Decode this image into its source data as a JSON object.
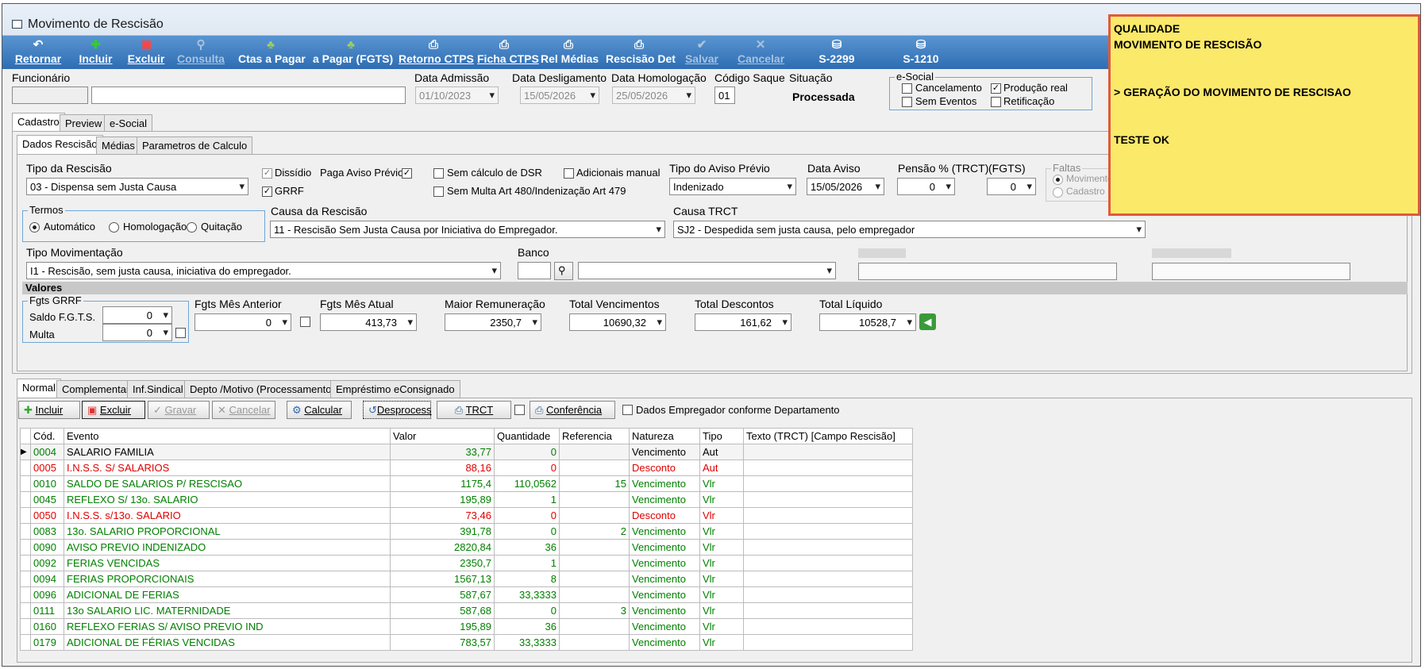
{
  "window": {
    "title": "Movimento de Rescisão"
  },
  "toolbar": [
    "Retornar",
    "Incluir",
    "Excluir",
    "Consulta",
    "Ctas a Pagar",
    "a Pagar (FGTS)",
    "Retorno CTPS",
    "Ficha CTPS",
    "Rel Médias",
    "Rescisão Det",
    "Salvar",
    "Cancelar",
    "S-2299",
    "S-1210"
  ],
  "header": {
    "funcionario_label": "Funcionário",
    "data_admissao_label": "Data Admissão",
    "data_admissao": "01/10/2023",
    "data_desligamento_label": "Data Desligamento",
    "data_desligamento": "15/05/2026",
    "data_homologacao_label": "Data Homologação",
    "data_homologacao": "25/05/2026",
    "codigo_saque_label": "Código Saque",
    "codigo_saque": "01",
    "situacao_label": "Situação",
    "situacao": "Processada",
    "esocial_label": "e-Social",
    "cancelamento": "Cancelamento",
    "producao_real": "Produção real",
    "sem_eventos": "Sem Eventos",
    "retificacao": "Retificação"
  },
  "note": {
    "l1": "QUALIDADE",
    "l2": "MOVIMENTO DE RESCISÃO",
    "l3": "> GERAÇÃO DO MOVIMENTO DE RESCISAO",
    "l4": "TESTE OK"
  },
  "tabs_top": [
    "Cadastro",
    "Preview",
    "e-Social"
  ],
  "tabs_sub": [
    "Dados Rescisão",
    "Médias",
    "Parametros de Calculo"
  ],
  "form": {
    "tipo_rescisao_label": "Tipo da Rescisão",
    "tipo_rescisao": "03 - Dispensa sem Justa Causa",
    "dissidio": "Dissídio",
    "grrf": "GRRF",
    "paga_aviso": "Paga Aviso Prévio",
    "sem_dsr": "Sem cálculo de DSR",
    "sem_multa": "Sem Multa Art 480/Indenização Art 479",
    "adicionais": "Adicionais manual",
    "tipo_aviso_label": "Tipo do Aviso Prévio",
    "tipo_aviso": "Indenizado",
    "data_aviso_label": "Data Aviso",
    "data_aviso": "15/05/2026",
    "pensao_label": "Pensão % (TRCT)",
    "pensao": "0",
    "fgts_label": "(FGTS)",
    "fgts": "0",
    "faltas_label": "Faltas",
    "movimento": "Movimento",
    "cadastro": "Cadastro",
    "termos_label": "Termos",
    "automatico": "Automático",
    "homologacao": "Homologação",
    "quitacao": "Quitação",
    "causa_label": "Causa da Rescisão",
    "causa": "11 - Rescisão Sem Justa Causa por Iniciativa do Empregador.",
    "causa_trct_label": "Causa TRCT",
    "causa_trct": "SJ2 - Despedida sem justa causa, pelo empregador",
    "tipo_mov_label": "Tipo Movimentação",
    "tipo_mov": "I1 - Rescisão, sem justa causa, iniciativa do empregador.",
    "banco_label": "Banco"
  },
  "valores": {
    "title": "Valores",
    "fgts_grrf": "Fgts GRRF",
    "saldo_label": "Saldo F.G.T.S.",
    "saldo": "0",
    "multa_label": "Multa",
    "multa": "0",
    "mes_ant_label": "Fgts Mês Anterior",
    "mes_ant": "0",
    "mes_atual_label": "Fgts Mês Atual",
    "mes_atual": "413,73",
    "maior_label": "Maior Remuneração",
    "maior": "2350,7",
    "venc_label": "Total Vencimentos",
    "venc": "10690,32",
    "desc_label": "Total Descontos",
    "desc": "161,62",
    "liq_label": "Total Líquido",
    "liq": "10528,7"
  },
  "tabs_bottom": [
    "Normal",
    "Complementar",
    "Inf.Sindical",
    "Depto /Motivo (Processamento)",
    "Empréstimo eConsignado"
  ],
  "actions": {
    "incluir": "Incluir",
    "excluir": "Excluir",
    "gravar": "Gravar",
    "cancelar": "Cancelar",
    "calcular": "Calcular",
    "desprocess": "Desprocess",
    "trct": "TRCT",
    "conferencia": "Conferência",
    "dados_emp": "Dados Empregador conforme Departamento"
  },
  "grid": {
    "columns": [
      "Cód.",
      "Evento",
      "Valor",
      "Quantidade",
      "Referencia",
      "Natureza",
      "Tipo",
      "Texto (TRCT) [Campo Rescisão]"
    ],
    "rows": [
      [
        "0004",
        "SALARIO FAMILIA",
        "33,77",
        "0",
        "",
        "Vencimento",
        "Aut"
      ],
      [
        "0005",
        "I.N.S.S. S/ SALARIOS",
        "88,16",
        "0",
        "",
        "Desconto",
        "Aut"
      ],
      [
        "0010",
        "SALDO DE SALARIOS P/ RESCISAO",
        "1175,4",
        "110,0562",
        "15",
        "Vencimento",
        "Vlr"
      ],
      [
        "0045",
        "REFLEXO S/ 13o. SALARIO",
        "195,89",
        "1",
        "",
        "Vencimento",
        "Vlr"
      ],
      [
        "0050",
        "I.N.S.S. s/13o. SALARIO",
        "73,46",
        "0",
        "",
        "Desconto",
        "Vlr"
      ],
      [
        "0083",
        "13o. SALARIO PROPORCIONAL",
        "391,78",
        "0",
        "2",
        "Vencimento",
        "Vlr"
      ],
      [
        "0090",
        "AVISO PREVIO INDENIZADO",
        "2820,84",
        "36",
        "",
        "Vencimento",
        "Vlr"
      ],
      [
        "0092",
        "FERIAS VENCIDAS",
        "2350,7",
        "1",
        "",
        "Vencimento",
        "Vlr"
      ],
      [
        "0094",
        "FERIAS PROPORCIONAIS",
        "1567,13",
        "8",
        "",
        "Vencimento",
        "Vlr"
      ],
      [
        "0096",
        "ADICIONAL DE FERIAS",
        "587,67",
        "33,3333",
        "",
        "Vencimento",
        "Vlr"
      ],
      [
        "0111",
        "13o SALARIO LIC. MATERNIDADE",
        "587,68",
        "0",
        "3",
        "Vencimento",
        "Vlr"
      ],
      [
        "0160",
        "REFLEXO FERIAS S/ AVISO PREVIO IND",
        "195,89",
        "36",
        "",
        "Vencimento",
        "Vlr"
      ],
      [
        "0179",
        "ADICIONAL DE FÉRIAS VENCIDAS",
        "783,57",
        "33,3333",
        "",
        "Vencimento",
        "Vlr"
      ]
    ]
  }
}
